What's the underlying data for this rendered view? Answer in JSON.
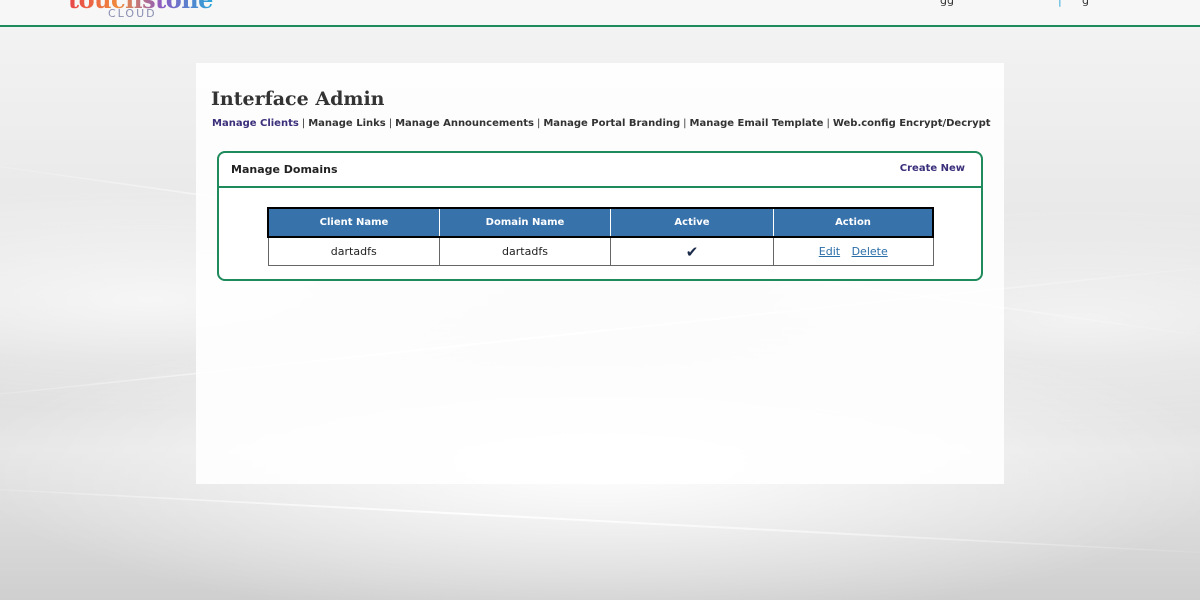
{
  "header": {
    "logo_text": "touchstone",
    "logo_sub": "CLOUD",
    "fragment_1": "gg",
    "fragment_2": "|",
    "fragment_3": "g"
  },
  "page": {
    "title": "Interface Admin"
  },
  "nav": {
    "items": [
      {
        "label": "Manage Clients",
        "active": true
      },
      {
        "label": "Manage Links",
        "active": false
      },
      {
        "label": "Manage Announcements",
        "active": false
      },
      {
        "label": "Manage Portal Branding",
        "active": false
      },
      {
        "label": "Manage Email Template",
        "active": false
      },
      {
        "label": "Web.config Encrypt/Decrypt",
        "active": false
      }
    ],
    "separator": "|"
  },
  "domains_panel": {
    "title": "Manage Domains",
    "create_label": "Create New",
    "columns": [
      "Client Name",
      "Domain Name",
      "Active",
      "Action"
    ],
    "rows": [
      {
        "client_name": "dartadfs",
        "domain_name": "dartadfs",
        "active": true,
        "active_glyph": "✔",
        "edit_label": "Edit",
        "delete_label": "Delete"
      }
    ]
  },
  "colors": {
    "accent_green": "#1f8a5b",
    "header_blue": "#3872ab",
    "link_purple": "#3a2f7a",
    "link_blue": "#2a6ea8"
  }
}
